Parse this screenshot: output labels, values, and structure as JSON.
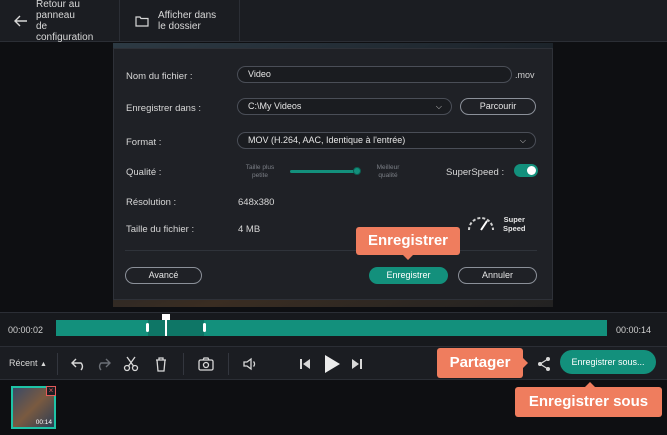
{
  "topbar": {
    "back_label": "Retour au panneau\nde configuration",
    "folder_label": "Afficher dans\nle dossier"
  },
  "dialog": {
    "filename_label": "Nom du fichier :",
    "filename_value": "Video",
    "filename_ext": ".mov",
    "save_in_label": "Enregistrer dans :",
    "save_in_value": "C:\\My Videos",
    "browse_label": "Parcourir",
    "format_label": "Format :",
    "format_value": "MOV (H.264, AAC, Identique à l'entrée)",
    "quality_label": "Qualité :",
    "quality_low": "Taille plus\npetite",
    "quality_high": "Meilleur\nqualité",
    "superspeed_label": "SuperSpeed :",
    "resolution_label": "Résolution :",
    "resolution_value": "648x380",
    "filesize_label": "Taille du fichier :",
    "filesize_value": "4 MB",
    "superspeed_badge": "Super\nSpeed",
    "advanced_label": "Avancé",
    "save_label": "Enregistrer",
    "cancel_label": "Annuler"
  },
  "callouts": {
    "save": "Enregistrer",
    "share": "Partager",
    "save_as": "Enregistrer sous"
  },
  "timeline": {
    "start_time": "00:00:02",
    "end_time": "00:00:14"
  },
  "toolbar": {
    "recent_label": "Récent",
    "save_as_label": "Enregistrer sous..."
  },
  "thumbnail": {
    "duration": "00:14"
  },
  "colors": {
    "accent": "#13907c",
    "callout": "#ef7d5e"
  }
}
